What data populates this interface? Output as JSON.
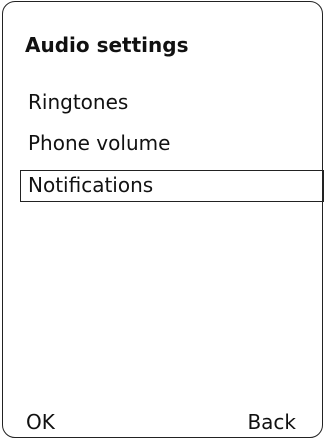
{
  "screen": {
    "title": "Audio settings"
  },
  "menu": {
    "items": [
      {
        "label": "Ringtones",
        "selected": false
      },
      {
        "label": "Phone volume",
        "selected": false
      },
      {
        "label": "Notifications",
        "selected": true
      }
    ]
  },
  "softkeys": {
    "left": "OK",
    "right": "Back"
  }
}
